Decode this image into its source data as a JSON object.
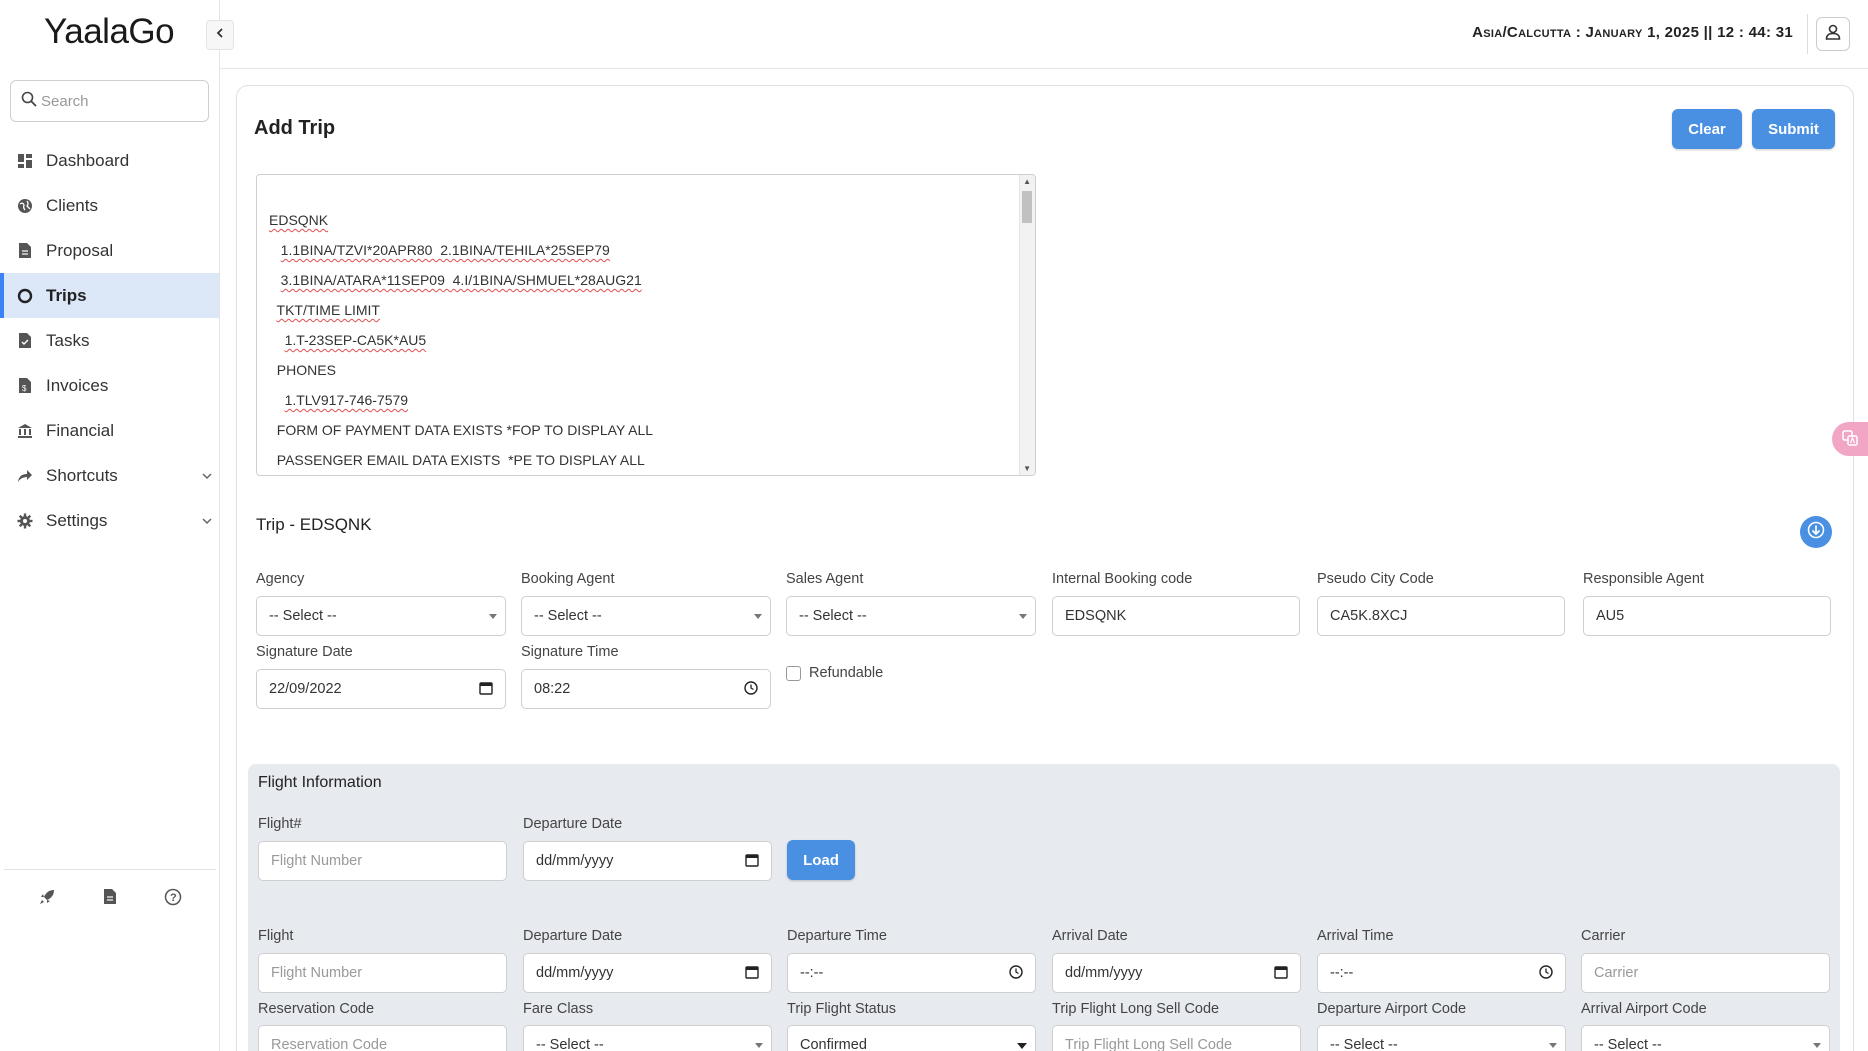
{
  "app": {
    "logo": "YaalaGo"
  },
  "search": {
    "placeholder": "Search"
  },
  "sidebar": {
    "items": [
      {
        "label": "Dashboard",
        "icon": "dashboard-icon"
      },
      {
        "label": "Clients",
        "icon": "globe-icon"
      },
      {
        "label": "Proposal",
        "icon": "document-icon"
      },
      {
        "label": "Trips",
        "icon": "circle-icon",
        "active": true
      },
      {
        "label": "Tasks",
        "icon": "task-icon"
      },
      {
        "label": "Invoices",
        "icon": "invoice-icon"
      },
      {
        "label": "Financial",
        "icon": "bank-icon"
      },
      {
        "label": "Shortcuts",
        "icon": "share-icon",
        "expandable": true
      },
      {
        "label": "Settings",
        "icon": "gear-icon",
        "expandable": true
      }
    ],
    "footer_icons": [
      "rocket-icon",
      "file-icon",
      "help-icon"
    ]
  },
  "header": {
    "clock": "Asia/Calcutta : January 1, 2025 || 12 : 44: 31"
  },
  "page": {
    "title": "Add Trip",
    "clear_label": "Clear",
    "submit_label": "Submit",
    "pnr_lines": [
      "EDSQNK",
      "   1.1BINA/TZVI*20APR80  2.1BINA/TEHILA*25SEP79",
      "   3.1BINA/ATARA*11SEP09  4.I/1BINA/SHMUEL*28AUG21",
      "  TKT/TIME LIMIT",
      "    1.T-23SEP-CA5K*AU5",
      "  PHONES",
      "    1.TLV917-746-7579",
      "  FORM OF PAYMENT DATA EXISTS *FOP TO DISPLAY ALL",
      "  PASSENGER EMAIL DATA EXISTS  *PE TO DISPLAY ALL"
    ]
  },
  "trip": {
    "title": "Trip - EDSQNK",
    "agency": {
      "label": "Agency",
      "value": "-- Select --"
    },
    "booking_agent": {
      "label": "Booking Agent",
      "value": "-- Select --"
    },
    "sales_agent": {
      "label": "Sales Agent",
      "value": "-- Select --"
    },
    "internal_booking_code": {
      "label": "Internal Booking code",
      "value": "EDSQNK"
    },
    "pseudo_city_code": {
      "label": "Pseudo City Code",
      "value": "CA5K.8XCJ"
    },
    "responsible_agent": {
      "label": "Responsible Agent",
      "value": "AU5"
    },
    "signature_date": {
      "label": "Signature Date",
      "value": "22/09/2022"
    },
    "signature_time": {
      "label": "Signature Time",
      "value": "08:22"
    },
    "refundable": {
      "label": "Refundable",
      "checked": false
    }
  },
  "flight_info": {
    "title": "Flight Information",
    "lookup": {
      "flight_label": "Flight#",
      "flight_placeholder": "Flight Number",
      "departure_date_label": "Departure Date",
      "departure_date_placeholder": "dd/mm/yyyy",
      "load_label": "Load"
    },
    "row1": {
      "flight": {
        "label": "Flight",
        "placeholder": "Flight Number"
      },
      "departure_date": {
        "label": "Departure Date",
        "placeholder": "dd/mm/yyyy"
      },
      "departure_time": {
        "label": "Departure Time",
        "placeholder": "--:--"
      },
      "arrival_date": {
        "label": "Arrival Date",
        "placeholder": "dd/mm/yyyy"
      },
      "arrival_time": {
        "label": "Arrival Time",
        "placeholder": "--:--"
      },
      "carrier": {
        "label": "Carrier",
        "placeholder": "Carrier"
      }
    },
    "row2": {
      "reservation_code": {
        "label": "Reservation Code",
        "placeholder": "Reservation Code"
      },
      "fare_class": {
        "label": "Fare Class",
        "value": "-- Select --"
      },
      "trip_flight_status": {
        "label": "Trip Flight Status",
        "value": "Confirmed"
      },
      "long_sell_code": {
        "label": "Trip Flight Long Sell Code",
        "placeholder": "Trip Flight Long Sell Code"
      },
      "departure_airport": {
        "label": "Departure Airport Code",
        "value": "-- Select --"
      },
      "arrival_airport": {
        "label": "Arrival Airport Code",
        "value": "-- Select --"
      }
    }
  },
  "colors": {
    "accent": "#4a90e2",
    "active_nav_bg": "#dce7f7",
    "panel_bg": "#e7eaef"
  }
}
